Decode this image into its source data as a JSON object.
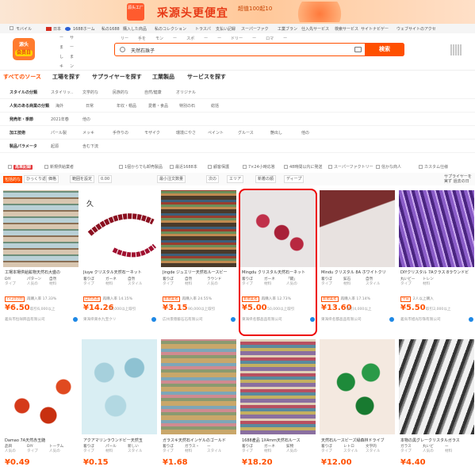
{
  "banner": {
    "tag": "采源头更便宜",
    "sub": "超值100起10",
    "logo_badge": "源头工厂"
  },
  "topnav": [
    "モバイル",
    "日本",
    "1688ホーム",
    "私の1688",
    "購入した商品",
    "私のコレクション",
    "トラスパ",
    "支払い記録",
    "スーパーファク",
    "工業ブラン",
    "仕入先サービス",
    "検索サービス",
    "サイトナビゲー",
    "ウェブサイトのアクセ"
  ],
  "logo": {
    "line1": "源头",
    "line2": "会员日"
  },
  "sidelist": [
    "ー",
    "ま",
    "し",
    "キ"
  ],
  "sidelist2": [
    "サ",
    "ー",
    "ま",
    "ン"
  ],
  "subtabs": [
    "リー",
    "手を",
    "モン",
    "ー",
    "スポ",
    "ー",
    "ー",
    "ドリー",
    "ー",
    "ロマ",
    "ー"
  ],
  "search": {
    "value": "天然石珠子",
    "button": "検索"
  },
  "cattabs": [
    "すべてのソース",
    "工場を探す",
    "サプライヤーを探す",
    "工業製品",
    "サービスを探す"
  ],
  "filters": [
    {
      "key": "スタイルの分類",
      "values": [
        "スタイリッ..",
        "文学的な",
        "民族的な",
        "自然/健康",
        "オリジナル"
      ]
    },
    {
      "key": "人気のある商業の分類",
      "values": [
        "海外",
        "日常",
        "年収・帽品",
        "愛着・食品",
        "特別の石",
        "総括"
      ]
    },
    {
      "key": "発売年・季節",
      "values": [
        "2021年春",
        "他の"
      ]
    },
    {
      "key": "加工技術",
      "values": [
        "パール製",
        "メッキ",
        "手作りの",
        "モザイク",
        "環境にやさ",
        "ペイント",
        "グルース",
        "艶出し",
        "他の"
      ]
    },
    {
      "key": "製品パラメータ",
      "values": [
        "起源",
        "含む下流"
      ]
    }
  ],
  "checks": [
    "再来記録",
    "新規供給業者",
    "1個からでも卸売製品",
    "最近1688本",
    "顧客保護",
    "7×24小時応答",
    "48時間以内に発送",
    "スーパーファクトリー",
    "信かな商人",
    "カスタム仕様"
  ],
  "sortbar": {
    "items": [
      "包括的な",
      "ひっくり返す",
      "価格",
      "範囲を設定",
      "最小注文数量",
      "次の",
      "エリア",
      "新着の順",
      "ディープ"
    ],
    "min": "0.00",
    "right": "サプライヤーを実ず 過去の日"
  },
  "products_row1": [
    {
      "title": "工場本場供給鉱物天然石大盛の",
      "a1l": "DIY",
      "a1": "タイプ",
      "a2l": "パターン",
      "a2": "人気の",
      "a3l": "自然",
      "a3": "材料",
      "tag": "7×24小時",
      "sold": "再購入率 17.33%",
      "price": "6.50",
      "count": "取引6,000以上",
      "shop": "義烏市恒祥飾品有限公司"
    },
    {
      "title": "Jiuye クリスタル天然石ーネット",
      "a1l": "着りぼ",
      "a1": "タイプ",
      "a2l": "ガーネ",
      "a2": "材料",
      "a3l": "自然",
      "a3": "スタイル",
      "tag": "自然水晶",
      "sold": "再購入率 14.15%",
      "price": "14.26",
      "count": "10,000以上取引",
      "shop": "東海県東水九宝クリ"
    },
    {
      "title": "Jingde ジュエリー天然石ルースビー",
      "a1l": "着りぼ",
      "a1": "タイプ",
      "a2l": "自然",
      "a2": "材料",
      "a3l": "ラウンド",
      "a3": "人気の",
      "tag": "新規業者",
      "sold": "再購入率 24.55%",
      "price": "3.15",
      "count": "90,000以上取引",
      "shop": "広州景徳藝石石有限公司"
    },
    {
      "title": "Mingdu クリスタル天然石ーネット",
      "a1l": "着りぼ",
      "a1": "タイプ",
      "a2l": "ガーネ",
      "a2": "材料",
      "a3l": "「闘」",
      "a3": "人気の",
      "tag": "新規業者",
      "sold": "再購入率 12.73%",
      "price": "5.00",
      "count": "50,000以上取引",
      "shop": "東海県名都晶品有限公司"
    },
    {
      "title": "Mindu クリスタル 8A ホワイトクリ",
      "a1l": "着りぼ",
      "a1": "タイプ",
      "a2l": "鉱石",
      "a2": "材料",
      "a3l": "自然",
      "a3": "スタイル",
      "tag": "新規業者",
      "sold": "再購入率 17.14%",
      "price": "13.60",
      "count": "取引4,000以上",
      "shop": "東海県名都晶品有限公司"
    },
    {
      "title": "DIYクリスタル 7Aクラス 8ラウンドビ",
      "a1l": "丸いビー",
      "a1": "タイプ",
      "a2l": "トレン",
      "a2": "材料",
      "a3l": "",
      "a3": "",
      "tag": "今日",
      "sold": "2人以上購入",
      "price": "5.50",
      "count": "取引2,000以上",
      "shop": "義烏市旭光珍珠有限公司"
    }
  ],
  "products_row2": [
    {
      "title": "Damao 7A天然赤玉髄",
      "a1l": "品目",
      "a1": "人気の",
      "a2l": "DIY",
      "a2": "タイプ",
      "a3l": "トーテム",
      "a3": "人気の",
      "tag": "1688產品",
      "sold": "再購入率 26.66%",
      "price": "0.49",
      "shop": "廣州市越秀区"
    },
    {
      "title": "アクアマリンラウンドビー天然玉",
      "a1l": "着りぼ",
      "a1": "タイプ",
      "a2l": "パール",
      "a2": "材料",
      "a3l": "新しい",
      "a3": "スタイル",
      "tag": "新規業者",
      "sold": "再購入率 15.65%",
      "price": "0.15",
      "shop": "東海県"
    },
    {
      "title": "ガラスキ天然石インゲルのゴールド",
      "a1l": "着りぼ",
      "a1": "タイプ",
      "a2l": "ガラス・",
      "a2": "材料",
      "a3l": "ー",
      "a3": "スタイル",
      "tag": "7×24小時",
      "sold": "再購入率 3.35%",
      "price": "1.68",
      "count": "10,000以上取引",
      "shop": "廣州"
    },
    {
      "title": "1688產品 1X4mm天然石ルース",
      "a1l": "着りぼ",
      "a1": "タイプ",
      "a2l": "ガーネ",
      "a2": "材料",
      "a3l": "鉱物",
      "a3": "人気の",
      "tag": "新規業者",
      "sold": "再購入率 21.42%",
      "price": "18.20",
      "count": "5,000以上取引",
      "shop": "東海県"
    },
    {
      "title": "天然石ルースビーズ緑森林ドライブ",
      "a1l": "着りぼ",
      "a1": "タイプ",
      "a2l": "レトロ",
      "a2": "スタイル",
      "a3l": "文学的",
      "a3": "スタイル",
      "tag": "新規業者",
      "sold": "再購入率 0.00%",
      "price": "12.00",
      "count": "100以上",
      "shop": "東海県"
    },
    {
      "title": "本物の黒グレークリスタルガラス",
      "a1l": "ガラス",
      "a1": "タイプ",
      "a2l": "丸いビ",
      "a2": "人気の",
      "a3l": "ー",
      "a3": "材料",
      "tag": "今日",
      "sold": "",
      "price": "4.40",
      "count": "60,000以上",
      "shop": "義烏市"
    }
  ],
  "colors": {
    "accent": "#ff5000",
    "highlight": "#e00000"
  }
}
